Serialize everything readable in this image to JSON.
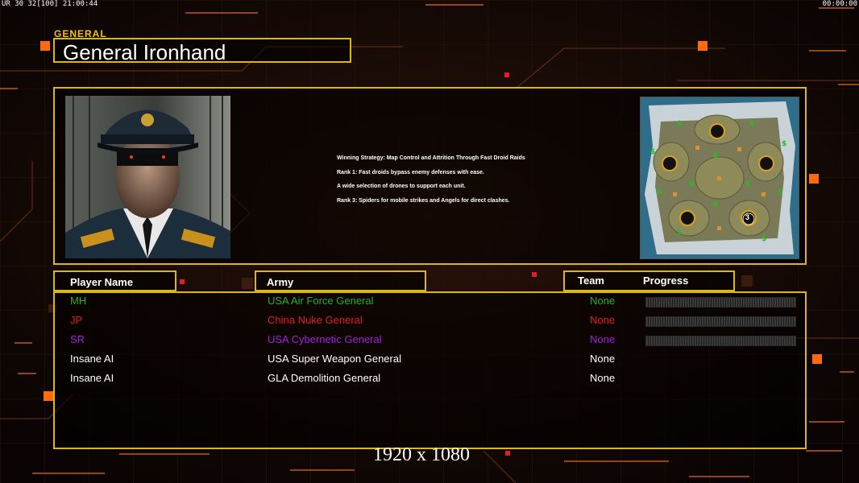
{
  "hud": {
    "left_text": "UR 30 32[100] 21:00:44",
    "right_text": "00:00:00"
  },
  "general_label": "GENERAL",
  "general_name": "General Ironhand",
  "strategy_lines": [
    "Winning Strategy: Map Control and Attrition Through Fast Droid Raids",
    "Rank 1: Fast droids bypass enemy defenses with ease.",
    "A wide selection of drones to support each unit.",
    "Rank 3: Spiders for mobile strikes and Angels for direct clashes."
  ],
  "minimap": {
    "player_badge": "3"
  },
  "headers": {
    "player_name": "Player Name",
    "army": "Army",
    "team": "Team",
    "progress": "Progress"
  },
  "players": [
    {
      "name": "MH",
      "army": "USA Air Force General",
      "team": "None",
      "color": "#22b422",
      "progress": 0
    },
    {
      "name": "JP",
      "army": "China Nuke General",
      "team": "None",
      "color": "#e81c1c",
      "progress": 0
    },
    {
      "name": "SR",
      "army": "USA Cybernetic General",
      "team": "None",
      "color": "#a020e0",
      "progress": 0
    },
    {
      "name": "Insane AI",
      "army": "USA Super Weapon General",
      "team": "None",
      "color": "#ffffff"
    },
    {
      "name": "Insane AI",
      "army": "GLA Demolition General",
      "team": "None",
      "color": "#ffffff"
    }
  ],
  "resolution_label": "1920 x 1080"
}
